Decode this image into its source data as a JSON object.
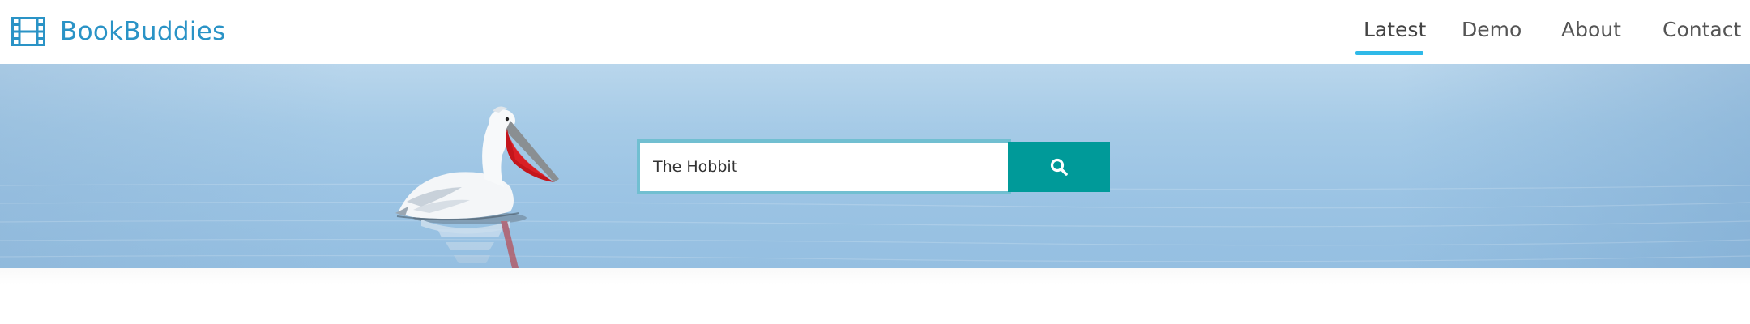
{
  "header": {
    "brand": {
      "name": "BookBuddies",
      "icon": "film-icon",
      "color": "#2a93c6"
    },
    "nav": [
      {
        "label": "Latest",
        "active": true
      },
      {
        "label": "Demo",
        "active": false
      },
      {
        "label": "About",
        "active": false
      },
      {
        "label": "Contact",
        "active": false
      }
    ],
    "active_indicator_color": "#2fb9e8"
  },
  "hero": {
    "background": "pelican-on-calm-water",
    "search": {
      "value": "The Hobbit",
      "button_icon": "search-icon",
      "button_color": "#009a99",
      "input_border_color": "#71bfd1"
    }
  }
}
